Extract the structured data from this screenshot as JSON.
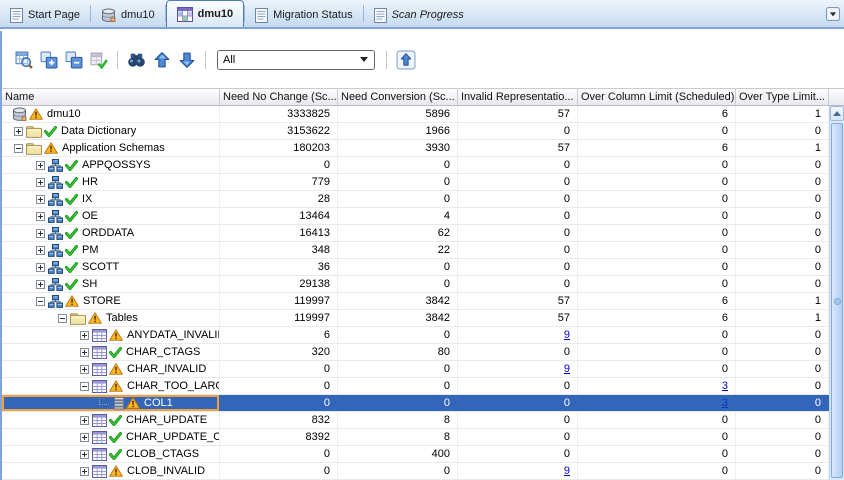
{
  "tabs": [
    {
      "label": "Start Page",
      "icon": "document",
      "active": false,
      "italic": false
    },
    {
      "label": "dmu10",
      "icon": "database",
      "active": false,
      "italic": false
    },
    {
      "label": "dmu10",
      "icon": "scan-report",
      "active": true,
      "italic": false
    },
    {
      "label": "Migration Status",
      "icon": "document",
      "active": false,
      "italic": false
    },
    {
      "label": "Scan Progress",
      "icon": "document",
      "active": false,
      "italic": true
    }
  ],
  "toolbar": {
    "filter_value": "All"
  },
  "table": {
    "columns": [
      "Name",
      "Need No Change (Sc...",
      "Need Conversion (Sc...",
      "Invalid Representatio...",
      "Over Column Limit (Scheduled)",
      "Over Type Limit..."
    ],
    "rows": [
      {
        "name": "dmu10",
        "level": 0,
        "expander": "none",
        "icon": "database",
        "status": "warning",
        "selected": false,
        "values": [
          "3333825",
          "5896",
          "57",
          "6",
          "1"
        ],
        "links": [
          false,
          false,
          false,
          false,
          false
        ]
      },
      {
        "name": "Data Dictionary",
        "level": 1,
        "expander": "plus",
        "icon": "folder",
        "status": "check",
        "selected": false,
        "values": [
          "3153622",
          "1966",
          "0",
          "0",
          "0"
        ],
        "links": [
          false,
          false,
          false,
          false,
          false
        ]
      },
      {
        "name": "Application Schemas",
        "level": 1,
        "expander": "minus",
        "icon": "folder",
        "status": "warning",
        "selected": false,
        "values": [
          "180203",
          "3930",
          "57",
          "6",
          "1"
        ],
        "links": [
          false,
          false,
          false,
          false,
          false
        ]
      },
      {
        "name": "APPQOSSYS",
        "level": 2,
        "expander": "plus",
        "icon": "schema",
        "status": "check",
        "selected": false,
        "values": [
          "0",
          "0",
          "0",
          "0",
          "0"
        ],
        "links": [
          false,
          false,
          false,
          false,
          false
        ]
      },
      {
        "name": "HR",
        "level": 2,
        "expander": "plus",
        "icon": "schema",
        "status": "check",
        "selected": false,
        "values": [
          "779",
          "0",
          "0",
          "0",
          "0"
        ],
        "links": [
          false,
          false,
          false,
          false,
          false
        ]
      },
      {
        "name": "IX",
        "level": 2,
        "expander": "plus",
        "icon": "schema",
        "status": "check",
        "selected": false,
        "values": [
          "28",
          "0",
          "0",
          "0",
          "0"
        ],
        "links": [
          false,
          false,
          false,
          false,
          false
        ]
      },
      {
        "name": "OE",
        "level": 2,
        "expander": "plus",
        "icon": "schema",
        "status": "check",
        "selected": false,
        "values": [
          "13464",
          "4",
          "0",
          "0",
          "0"
        ],
        "links": [
          false,
          false,
          false,
          false,
          false
        ]
      },
      {
        "name": "ORDDATA",
        "level": 2,
        "expander": "plus",
        "icon": "schema",
        "status": "check",
        "selected": false,
        "values": [
          "16413",
          "62",
          "0",
          "0",
          "0"
        ],
        "links": [
          false,
          false,
          false,
          false,
          false
        ]
      },
      {
        "name": "PM",
        "level": 2,
        "expander": "plus",
        "icon": "schema",
        "status": "check",
        "selected": false,
        "values": [
          "348",
          "22",
          "0",
          "0",
          "0"
        ],
        "links": [
          false,
          false,
          false,
          false,
          false
        ]
      },
      {
        "name": "SCOTT",
        "level": 2,
        "expander": "plus",
        "icon": "schema",
        "status": "check",
        "selected": false,
        "values": [
          "36",
          "0",
          "0",
          "0",
          "0"
        ],
        "links": [
          false,
          false,
          false,
          false,
          false
        ]
      },
      {
        "name": "SH",
        "level": 2,
        "expander": "plus",
        "icon": "schema",
        "status": "check",
        "selected": false,
        "values": [
          "29138",
          "0",
          "0",
          "0",
          "0"
        ],
        "links": [
          false,
          false,
          false,
          false,
          false
        ]
      },
      {
        "name": "STORE",
        "level": 2,
        "expander": "minus",
        "icon": "schema",
        "status": "warning",
        "selected": false,
        "values": [
          "119997",
          "3842",
          "57",
          "6",
          "1"
        ],
        "links": [
          false,
          false,
          false,
          false,
          false
        ]
      },
      {
        "name": "Tables",
        "level": 3,
        "expander": "minus",
        "icon": "folder",
        "status": "warning",
        "selected": false,
        "values": [
          "119997",
          "3842",
          "57",
          "6",
          "1"
        ],
        "links": [
          false,
          false,
          false,
          false,
          false
        ]
      },
      {
        "name": "ANYDATA_INVALID",
        "level": 4,
        "expander": "plus",
        "icon": "table",
        "status": "warning",
        "selected": false,
        "values": [
          "6",
          "0",
          "9",
          "0",
          "0"
        ],
        "links": [
          false,
          false,
          true,
          false,
          false
        ]
      },
      {
        "name": "CHAR_CTAGS",
        "level": 4,
        "expander": "plus",
        "icon": "table",
        "status": "check",
        "selected": false,
        "values": [
          "320",
          "80",
          "0",
          "0",
          "0"
        ],
        "links": [
          false,
          false,
          false,
          false,
          false
        ]
      },
      {
        "name": "CHAR_INVALID",
        "level": 4,
        "expander": "plus",
        "icon": "table",
        "status": "warning",
        "selected": false,
        "values": [
          "0",
          "0",
          "9",
          "0",
          "0"
        ],
        "links": [
          false,
          false,
          true,
          false,
          false
        ]
      },
      {
        "name": "CHAR_TOO_LARGE",
        "level": 4,
        "expander": "minus",
        "icon": "table",
        "status": "warning",
        "selected": false,
        "values": [
          "0",
          "0",
          "0",
          "3",
          "0"
        ],
        "links": [
          false,
          false,
          false,
          true,
          false
        ]
      },
      {
        "name": "COL1",
        "level": 5,
        "expander": "leaf",
        "icon": "column",
        "status": "warning",
        "selected": true,
        "values": [
          "0",
          "0",
          "0",
          "3",
          "0"
        ],
        "links": [
          false,
          false,
          false,
          true,
          false
        ]
      },
      {
        "name": "CHAR_UPDATE",
        "level": 4,
        "expander": "plus",
        "icon": "table",
        "status": "check",
        "selected": false,
        "values": [
          "832",
          "8",
          "0",
          "0",
          "0"
        ],
        "links": [
          false,
          false,
          false,
          false,
          false
        ]
      },
      {
        "name": "CHAR_UPDATE_OI",
        "level": 4,
        "expander": "plus",
        "icon": "table",
        "status": "check",
        "selected": false,
        "values": [
          "8392",
          "8",
          "0",
          "0",
          "0"
        ],
        "links": [
          false,
          false,
          false,
          false,
          false
        ]
      },
      {
        "name": "CLOB_CTAGS",
        "level": 4,
        "expander": "plus",
        "icon": "table",
        "status": "check",
        "selected": false,
        "values": [
          "0",
          "400",
          "0",
          "0",
          "0"
        ],
        "links": [
          false,
          false,
          false,
          false,
          false
        ]
      },
      {
        "name": "CLOB_INVALID",
        "level": 4,
        "expander": "plus",
        "icon": "table",
        "status": "warning",
        "selected": false,
        "values": [
          "0",
          "0",
          "9",
          "0",
          "0"
        ],
        "links": [
          false,
          false,
          true,
          false,
          false
        ]
      }
    ]
  },
  "colors": {
    "selection": "#3365B8",
    "link": "#0000CC",
    "focus_outline": "#F0A13C",
    "warning": "#FFB81E",
    "check": "#1FA11F",
    "panel_border": "#7EA4D8"
  }
}
